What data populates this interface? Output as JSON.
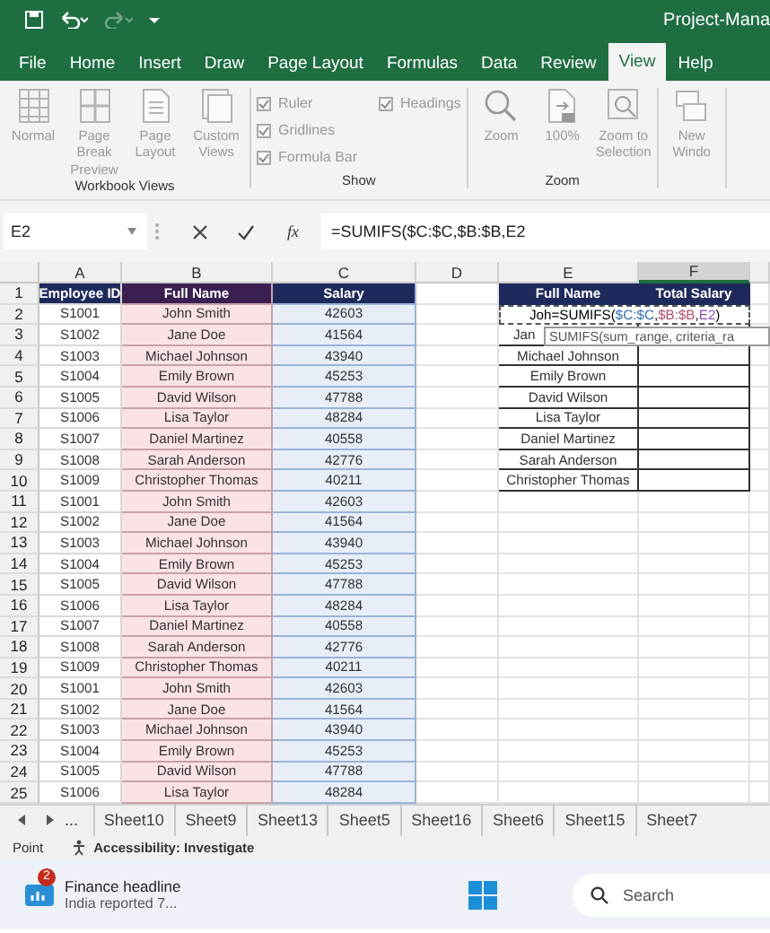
{
  "title_bar": {
    "title": "Project-Mana"
  },
  "ribbon_tabs": [
    {
      "label": "File",
      "selected": false
    },
    {
      "label": "Home",
      "selected": false
    },
    {
      "label": "Insert",
      "selected": false
    },
    {
      "label": "Draw",
      "selected": false
    },
    {
      "label": "Page Layout",
      "selected": false
    },
    {
      "label": "Formulas",
      "selected": false
    },
    {
      "label": "Data",
      "selected": false
    },
    {
      "label": "Review",
      "selected": false
    },
    {
      "label": "View",
      "selected": true
    },
    {
      "label": "Help",
      "selected": false
    }
  ],
  "ribbon_groups": [
    {
      "label": "Workbook Views",
      "items": [
        {
          "kind": "button",
          "label": "Normal"
        },
        {
          "kind": "button",
          "label": "Page Break Preview"
        },
        {
          "kind": "button",
          "label": "Page Layout"
        },
        {
          "kind": "button",
          "label": "Custom Views"
        }
      ]
    },
    {
      "label": "Show",
      "items": [
        {
          "kind": "checkbox",
          "label": "Ruler",
          "checked": true
        },
        {
          "kind": "checkbox",
          "label": "Gridlines",
          "checked": true
        },
        {
          "kind": "checkbox",
          "label": "Formula Bar",
          "checked": true
        },
        {
          "kind": "checkbox",
          "label": "Headings",
          "checked": true
        }
      ]
    },
    {
      "label": "Zoom",
      "items": [
        {
          "kind": "button",
          "label": "Zoom"
        },
        {
          "kind": "button",
          "label": "100%"
        },
        {
          "kind": "button",
          "label": "Zoom to Selection"
        }
      ]
    },
    {
      "items": [
        {
          "kind": "button",
          "label": "New Windo"
        }
      ]
    }
  ],
  "formula_bar": {
    "name_box": "E2",
    "fx": "fx",
    "formula": "=SUMIFS($C:$C,$B:$B,E2"
  },
  "columns": [
    {
      "label": "A",
      "selected": false
    },
    {
      "label": "B",
      "selected": false
    },
    {
      "label": "C",
      "selected": false
    },
    {
      "label": "D",
      "selected": false
    },
    {
      "label": "E",
      "selected": false
    },
    {
      "label": "F",
      "selected": true
    }
  ],
  "rows": [
    {
      "number": "1",
      "kind": "header",
      "a": "Employee ID",
      "b": "Full Name",
      "c": "Salary",
      "e": "Full Name",
      "f": "Total Salary"
    },
    {
      "number": "2",
      "kind": "data",
      "a": "S1001",
      "b": "John Smith",
      "c": "42603",
      "edit": [
        {
          "text": "Joh=SUMIFS("
        },
        {
          "text": "$C:$C",
          "color": "#2f6fb0"
        },
        {
          "text": ","
        },
        {
          "text": "$B:$B",
          "color": "#b0506a"
        },
        {
          "text": ","
        },
        {
          "text": "E2",
          "color": "#8a4fb0"
        },
        {
          "text": ")"
        }
      ]
    },
    {
      "number": "3",
      "kind": "data",
      "a": "S1002",
      "b": "Jane Doe",
      "c": "41564",
      "e": "Jan",
      "tooltip": "SUMIFS(sum_range, criteria_ra"
    },
    {
      "number": "4",
      "kind": "data",
      "a": "S1003",
      "b": "Michael Johnson",
      "c": "43940",
      "e": "Michael Johnson"
    },
    {
      "number": "5",
      "kind": "data",
      "a": "S1004",
      "b": "Emily Brown",
      "c": "45253",
      "e": "Emily Brown"
    },
    {
      "number": "6",
      "kind": "data",
      "a": "S1005",
      "b": "David Wilson",
      "c": "47788",
      "e": "David Wilson"
    },
    {
      "number": "7",
      "kind": "data",
      "a": "S1006",
      "b": "Lisa Taylor",
      "c": "48284",
      "e": "Lisa Taylor"
    },
    {
      "number": "8",
      "kind": "data",
      "a": "S1007",
      "b": "Daniel Martinez",
      "c": "40558",
      "e": "Daniel Martinez"
    },
    {
      "number": "9",
      "kind": "data",
      "a": "S1008",
      "b": "Sarah Anderson",
      "c": "42776",
      "e": "Sarah Anderson"
    },
    {
      "number": "10",
      "kind": "data",
      "a": "S1009",
      "b": "Christopher Thomas",
      "c": "40211",
      "e": "Christopher Thomas"
    },
    {
      "number": "11",
      "kind": "data",
      "a": "S1001",
      "b": "John Smith",
      "c": "42603"
    },
    {
      "number": "12",
      "kind": "data",
      "a": "S1002",
      "b": "Jane Doe",
      "c": "41564"
    },
    {
      "number": "13",
      "kind": "data",
      "a": "S1003",
      "b": "Michael Johnson",
      "c": "43940"
    },
    {
      "number": "14",
      "kind": "data",
      "a": "S1004",
      "b": "Emily Brown",
      "c": "45253"
    },
    {
      "number": "15",
      "kind": "data",
      "a": "S1005",
      "b": "David Wilson",
      "c": "47788"
    },
    {
      "number": "16",
      "kind": "data",
      "a": "S1006",
      "b": "Lisa Taylor",
      "c": "48284"
    },
    {
      "number": "17",
      "kind": "data",
      "a": "S1007",
      "b": "Daniel Martinez",
      "c": "40558"
    },
    {
      "number": "18",
      "kind": "data",
      "a": "S1008",
      "b": "Sarah Anderson",
      "c": "42776"
    },
    {
      "number": "19",
      "kind": "data",
      "a": "S1009",
      "b": "Christopher Thomas",
      "c": "40211"
    },
    {
      "number": "20",
      "kind": "data",
      "a": "S1001",
      "b": "John Smith",
      "c": "42603"
    },
    {
      "number": "21",
      "kind": "data",
      "a": "S1002",
      "b": "Jane Doe",
      "c": "41564"
    },
    {
      "number": "22",
      "kind": "data",
      "a": "S1003",
      "b": "Michael Johnson",
      "c": "43940"
    },
    {
      "number": "23",
      "kind": "data",
      "a": "S1004",
      "b": "Emily Brown",
      "c": "45253"
    },
    {
      "number": "24",
      "kind": "data",
      "a": "S1005",
      "b": "David Wilson",
      "c": "47788"
    },
    {
      "number": "25",
      "kind": "data",
      "a": "S1006",
      "b": "Lisa Taylor",
      "c": "48284"
    }
  ],
  "sheet_nav": "...",
  "sheet_tabs": [
    {
      "label": "Sheet10"
    },
    {
      "label": "Sheet9"
    },
    {
      "label": "Sheet13"
    },
    {
      "label": "Sheet5"
    },
    {
      "label": "Sheet16"
    },
    {
      "label": "Sheet6"
    },
    {
      "label": "Sheet15"
    },
    {
      "label": "Sheet7"
    }
  ],
  "status_bar": {
    "mode": "Point",
    "accessibility": "Accessibility: Investigate"
  },
  "taskbar": {
    "badge": "2",
    "news_title": "Finance headline",
    "news_text": "India reported 7...",
    "search_placeholder": "Search"
  }
}
